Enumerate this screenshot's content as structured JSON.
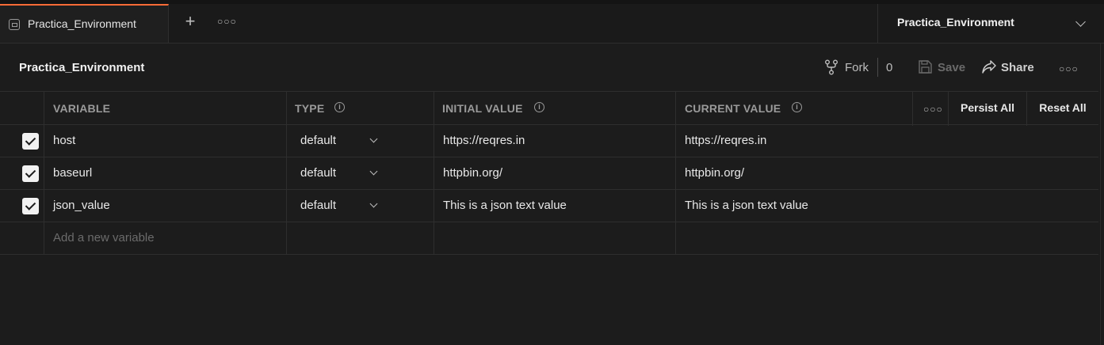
{
  "tabs": [
    {
      "label": "Practica_Environment",
      "active": true
    }
  ],
  "env_selector": {
    "selected": "Practica_Environment"
  },
  "page": {
    "title": "Practica_Environment"
  },
  "actions": {
    "fork": "Fork",
    "fork_count": "0",
    "save": "Save",
    "share": "Share"
  },
  "table": {
    "headers": {
      "variable": "VARIABLE",
      "type": "TYPE",
      "initial_value": "INITIAL VALUE",
      "current_value": "CURRENT VALUE"
    },
    "persist_all": "Persist All",
    "reset_all": "Reset All",
    "rows": [
      {
        "checked": true,
        "variable": "host",
        "type": "default",
        "initial_value": "https://reqres.in",
        "current_value": "https://reqres.in"
      },
      {
        "checked": true,
        "variable": "baseurl",
        "type": "default",
        "initial_value": "httpbin.org/",
        "current_value": "httpbin.org/"
      },
      {
        "checked": true,
        "variable": "json_value",
        "type": "default",
        "initial_value": "This is a json text value",
        "current_value": "This is a json text value"
      }
    ],
    "new_variable_placeholder": "Add a new variable"
  },
  "colors": {
    "background": "#1c1c1c",
    "accent": "#ff6c37",
    "border": "#2e2e2e",
    "header_text": "#9a9a9a"
  },
  "icons": {
    "tab": "environment-icon",
    "add": "plus-icon",
    "more": "more-horizontal-icon",
    "fork": "fork-icon",
    "save": "save-icon",
    "share": "share-icon",
    "info": "info-icon",
    "dropdown": "chevron-down-icon"
  }
}
